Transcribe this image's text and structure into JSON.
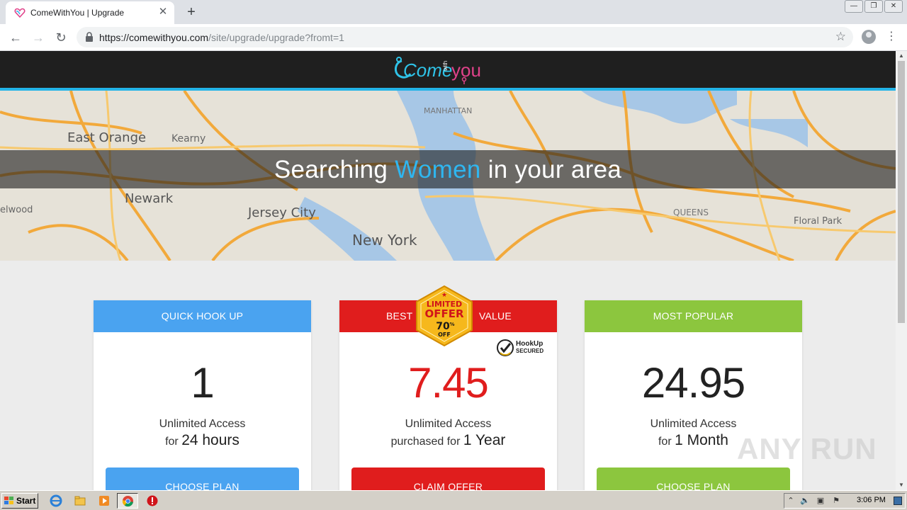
{
  "browser": {
    "tab_title": "ComeWithYou | Upgrade",
    "tab_close": "✕",
    "new_tab": "+",
    "url_host": "https://comewithyou.com",
    "url_path": "/site/upgrade/upgrade?fromt=1",
    "back": "←",
    "forward": "→",
    "reload": "↻",
    "star": "☆",
    "menu": "⋮",
    "window_buttons": [
      "—",
      "❐",
      "✕"
    ]
  },
  "site": {
    "logo_part1": "Come",
    "logo_with": "with",
    "logo_part2": "you",
    "hero_prefix": "Searching ",
    "hero_highlight": "Women",
    "hero_suffix": " in your area",
    "map_labels": [
      "East Orange",
      "Kearny",
      "Newark",
      "Jersey City",
      "New York",
      "MANHATTAN",
      "QUEENS",
      "Floral Park",
      "elwood"
    ]
  },
  "plans": [
    {
      "header": "QUICK HOOK UP",
      "price": "1",
      "desc1": "Unlimited Access",
      "desc2_prefix": "for ",
      "desc2_bold": "24 hours",
      "button": "CHOOSE PLAN",
      "color": "#4aa3f0",
      "price_color": "#222222"
    },
    {
      "header_left": "BEST",
      "header_right": "VALUE",
      "price": "7.45",
      "desc1": "Unlimited Access",
      "desc2_prefix": "purchased for ",
      "desc2_bold": "1 Year",
      "button": "CLAIM OFFER",
      "color": "#e01d1d",
      "price_color": "#e01d1d"
    },
    {
      "header": "MOST POPULAR",
      "price": "24.95",
      "desc1": "Unlimited Access",
      "desc2_prefix": "for ",
      "desc2_bold": "1 Month",
      "button": "CHOOSE PLAN",
      "color": "#8cc63e",
      "price_color": "#222222"
    }
  ],
  "badge": {
    "line1": "LIMITED",
    "line2": "OFFER",
    "line3": "70",
    "percent": "%",
    "line4": "OFF",
    "star": "★"
  },
  "secured": {
    "line1": "HookUp",
    "line2": "SECURED"
  },
  "watermark": "ANY RUN",
  "taskbar": {
    "start": "Start",
    "clock": "3:06 PM"
  }
}
